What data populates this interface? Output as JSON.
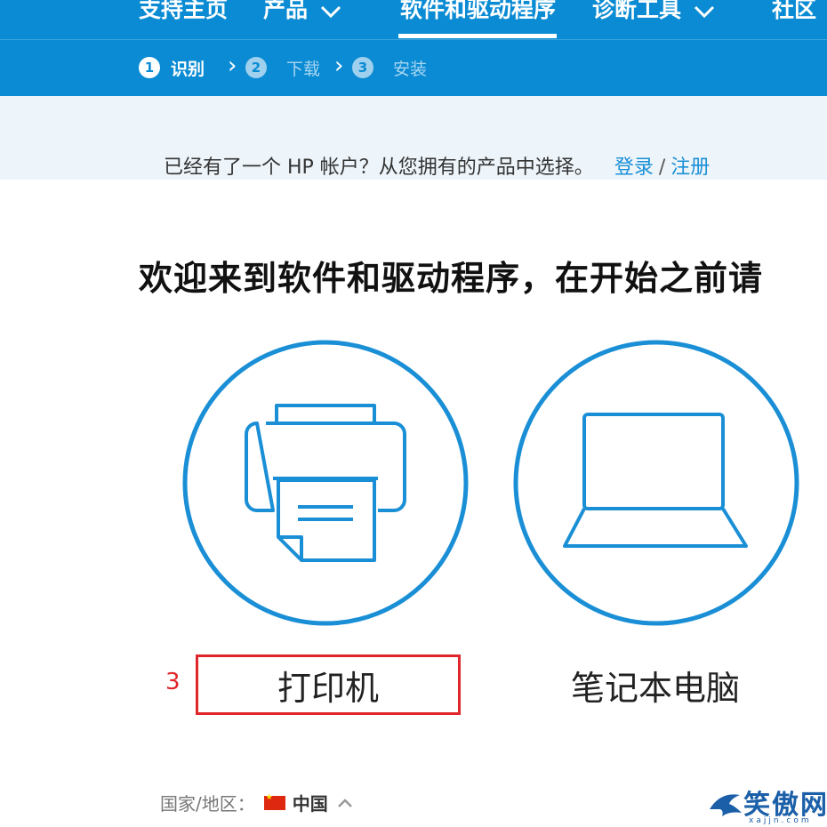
{
  "topnav": {
    "items": [
      {
        "label": "支持主页"
      },
      {
        "label": "产品"
      },
      {
        "label": "软件和驱动程序"
      },
      {
        "label": "诊断工具"
      },
      {
        "label": "社区"
      }
    ]
  },
  "steps": [
    {
      "num": "1",
      "label": "识别"
    },
    {
      "num": "2",
      "label": "下载"
    },
    {
      "num": "3",
      "label": "安装"
    }
  ],
  "account": {
    "prompt": "已经有了一个 HP 帐户？从您拥有的产品中选择。",
    "login_label": "登录",
    "separator": "/",
    "register_label": "注册"
  },
  "heading": "欢迎来到软件和驱动程序，在开始之前请",
  "products": {
    "printer_label": "打印机",
    "laptop_label": "笔记本电脑"
  },
  "annotation": "3",
  "footer": {
    "region_label": "国家/地区：",
    "region_value": "中国"
  },
  "watermark": {
    "text": "笑傲网",
    "sub": "xajjn.com"
  },
  "colors": {
    "brand_blue": "#0a8bd3",
    "icon_blue": "#1a8fd6",
    "highlight_red": "#e0262b"
  }
}
